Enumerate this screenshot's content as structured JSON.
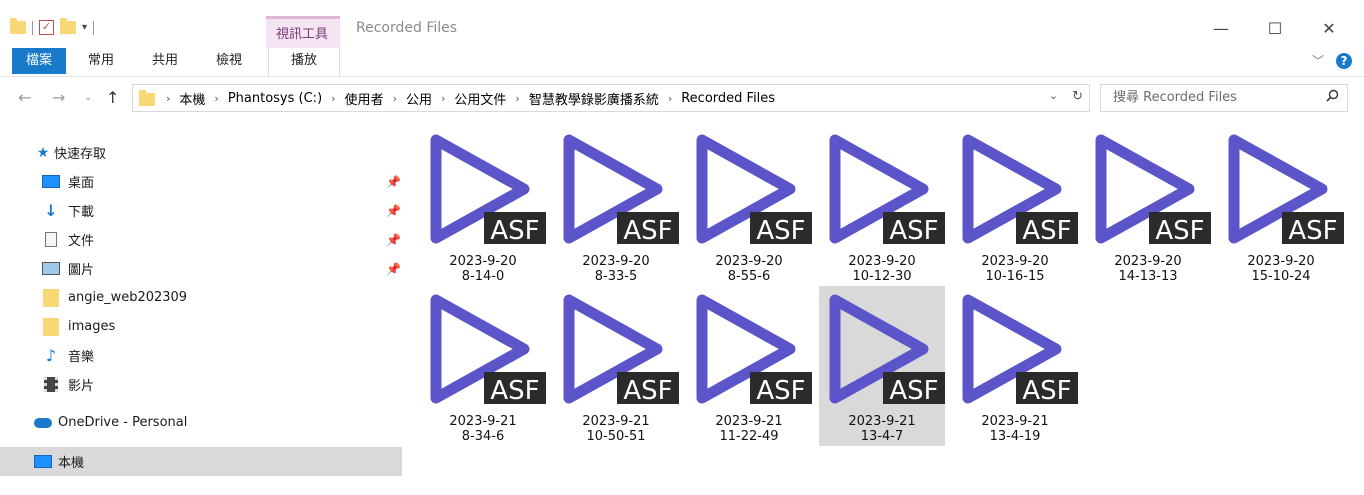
{
  "window": {
    "title": "Recorded Files",
    "context_tab_label": "視訊工具",
    "minimize": "—",
    "maximize": "☐",
    "close": "✕"
  },
  "ribbon": {
    "tabs": [
      "檔案",
      "常用",
      "共用",
      "檢視",
      "播放"
    ]
  },
  "address": {
    "crumbs": [
      "本機",
      "Phantosys (C:)",
      "使用者",
      "公用",
      "公用文件",
      "智慧教學錄影廣播系統",
      "Recorded Files"
    ]
  },
  "search": {
    "placeholder": "搜尋 Recorded Files"
  },
  "sidebar": {
    "items": [
      {
        "label": "快速存取",
        "icon": "star-icon"
      },
      {
        "label": "桌面",
        "icon": "desktop-icon",
        "pinned": true
      },
      {
        "label": "下載",
        "icon": "download-icon",
        "pinned": true
      },
      {
        "label": "文件",
        "icon": "document-icon",
        "pinned": true
      },
      {
        "label": "圖片",
        "icon": "pictures-icon",
        "pinned": true
      },
      {
        "label": "angie_web202309",
        "icon": "folder-icon"
      },
      {
        "label": "images",
        "icon": "folder-icon"
      },
      {
        "label": "音樂",
        "icon": "music-icon"
      },
      {
        "label": "影片",
        "icon": "video-icon"
      },
      {
        "label": "OneDrive - Personal",
        "icon": "cloud-icon"
      },
      {
        "label": "本機",
        "icon": "computer-icon",
        "selected": true
      }
    ]
  },
  "files": [
    {
      "line1": "2023-9-20",
      "line2": "8-14-0"
    },
    {
      "line1": "2023-9-20",
      "line2": "8-33-5"
    },
    {
      "line1": "2023-9-20",
      "line2": "8-55-6"
    },
    {
      "line1": "2023-9-20",
      "line2": "10-12-30"
    },
    {
      "line1": "2023-9-20",
      "line2": "10-16-15"
    },
    {
      "line1": "2023-9-20",
      "line2": "14-13-13"
    },
    {
      "line1": "2023-9-20",
      "line2": "15-10-24"
    },
    {
      "line1": "2023-9-21",
      "line2": "8-34-6"
    },
    {
      "line1": "2023-9-21",
      "line2": "10-50-51"
    },
    {
      "line1": "2023-9-21",
      "line2": "11-22-49"
    },
    {
      "line1": "2023-9-21",
      "line2": "13-4-7",
      "selected": true
    },
    {
      "line1": "2023-9-21",
      "line2": "13-4-19"
    }
  ],
  "file_badge": "ASF",
  "colors": {
    "play_icon": "#5b55c9",
    "badge_bg": "#2b2b2b",
    "accent": "#1979ca",
    "selection": "#d9d9d9"
  }
}
